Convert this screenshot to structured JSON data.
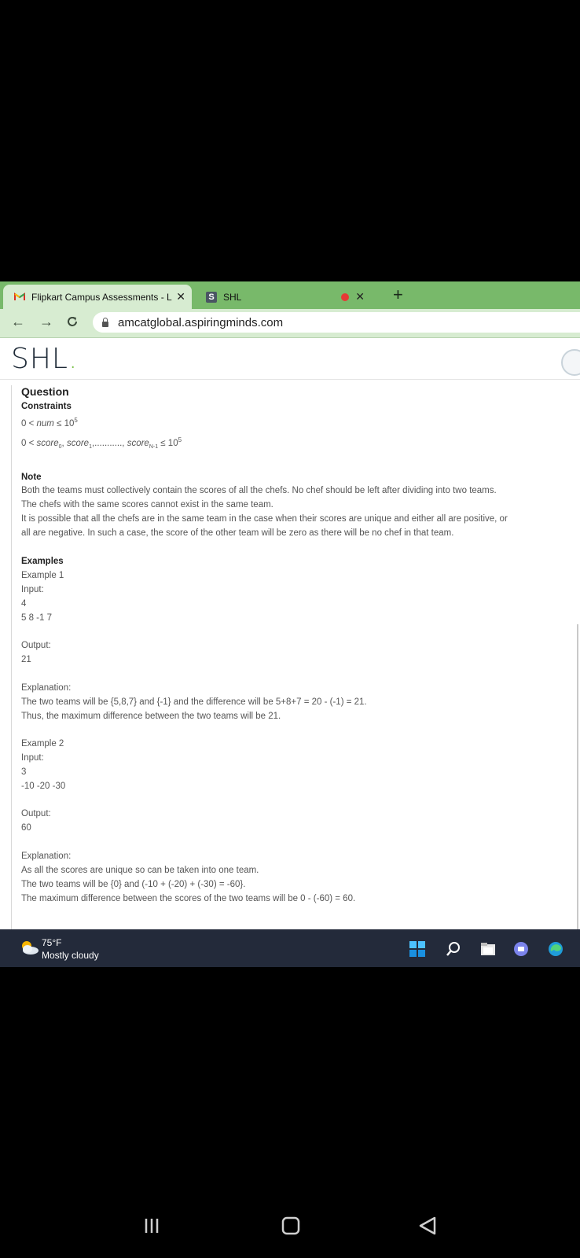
{
  "browser": {
    "tabs": [
      {
        "label": "Flipkart Campus Assessments - L",
        "close": "✕"
      },
      {
        "label": "SHL",
        "close": "✕"
      }
    ],
    "new_tab": "+",
    "url": "amcatglobal.aspiringminds.com"
  },
  "app": {
    "logo": "SHL",
    "logo_dot": "."
  },
  "question": {
    "heading": "Question",
    "constraints_heading": "Constraints",
    "constraint1": {
      "prefix": "0 < ",
      "var": "num",
      "mid": " ≤ 10",
      "sup": "5"
    },
    "constraint2": {
      "prefix": "0 < ",
      "v0": "score",
      "s0": "0",
      "sep0": ", ",
      "v1": "score",
      "s1": "1",
      "sep1": ",..........., ",
      "vn": "score",
      "sn": "N-1",
      "mid": " ≤ 10",
      "sup": "5"
    },
    "note_heading": "Note",
    "note_lines": [
      "Both the teams must collectively contain the scores of all the chefs. No chef should be left after dividing into two teams.",
      "The chefs with the same scores cannot exist in the same team.",
      "It is possible that all the chefs are in the same team in the case when their scores are unique and either all are positive, or",
      "all are negative. In such a case, the score of the other team will be zero as there will be no chef in that team."
    ],
    "examples_heading": "Examples",
    "example1": {
      "title": "Example 1",
      "input_label": "Input:",
      "input_lines": [
        "4",
        "5 8 -1 7"
      ],
      "output_label": "Output:",
      "output": "21",
      "explanation_label": "Explanation:",
      "explanation_lines": [
        "The two teams will be {5,8,7} and {-1} and the difference will be 5+8+7 = 20 - (-1) = 21.",
        "Thus, the maximum difference between the two teams will be 21."
      ]
    },
    "example2": {
      "title": "Example 2",
      "input_label": "Input:",
      "input_lines": [
        "3",
        "-10 -20 -30"
      ],
      "output_label": "Output:",
      "output": "60",
      "explanation_label": "Explanation:",
      "explanation_lines": [
        "As all the scores are unique so can be taken into one team.",
        "The two teams will be {0} and (-10 + (-20) + (-30) = -60}.",
        "The maximum difference between the scores of the two teams will be 0 - (-60) = 60."
      ]
    }
  },
  "taskbar": {
    "temperature": "75°F",
    "condition": "Mostly cloudy",
    "icons": [
      "windows-start-icon",
      "search-icon",
      "file-explorer-icon",
      "teams-chat-icon",
      "edge-browser-icon"
    ]
  },
  "android_nav": {
    "icons": [
      "recents-icon",
      "home-icon",
      "back-icon"
    ]
  }
}
